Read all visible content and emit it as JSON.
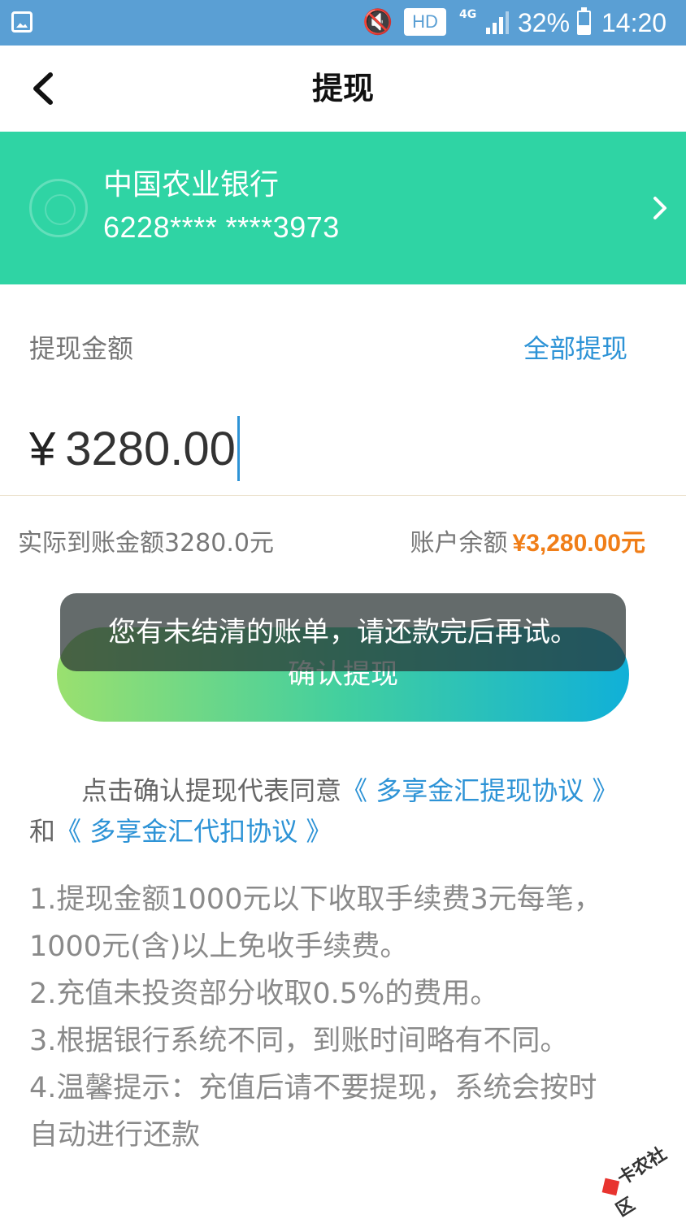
{
  "status_bar": {
    "hd": "HD",
    "network": "4G",
    "battery": "32%",
    "time": "14:20"
  },
  "nav": {
    "title": "提现"
  },
  "bank_card": {
    "bank_name": "中国农业银行",
    "card_number": "6228**** ****3973",
    "background": "#2fd4a4"
  },
  "amount": {
    "label": "提现金额",
    "withdraw_all": "全部提现",
    "currency": "¥",
    "value": "3280.00"
  },
  "info": {
    "actual_amount": "实际到账金额3280.0元",
    "balance_label": "账户余额",
    "balance_value": "¥3,280.00元",
    "balance_color": "#f07e18"
  },
  "confirm_button": {
    "label": "确认提现"
  },
  "toast": {
    "message": "您有未结清的账单，请还款完后再试。"
  },
  "agreement": {
    "prefix": "点击确认提现代表同意",
    "link1": "《 多享金汇提现协议 》",
    "middle": "和",
    "link2": "《 多享金汇代扣协议 》"
  },
  "notes": [
    "1.提现金额1000元以下收取手续费3元每笔，",
    "1000元(含)以上免收手续费。",
    "2.充值未投资部分收取0.5%的费用。",
    "3.根据银行系统不同，到账时间略有不同。",
    "4.温馨提示：充值后请不要提现，系统会按时",
    "自动进行还款"
  ],
  "watermark": {
    "text": "卡农社区"
  },
  "colors": {
    "accent_blue": "#2d93d6",
    "status_bar": "#5a9fd4"
  },
  "icons": [
    "gallery-icon",
    "mute-icon",
    "signal-icon",
    "battery-icon",
    "back-icon",
    "bank-logo-icon",
    "chevron-right-icon"
  ]
}
